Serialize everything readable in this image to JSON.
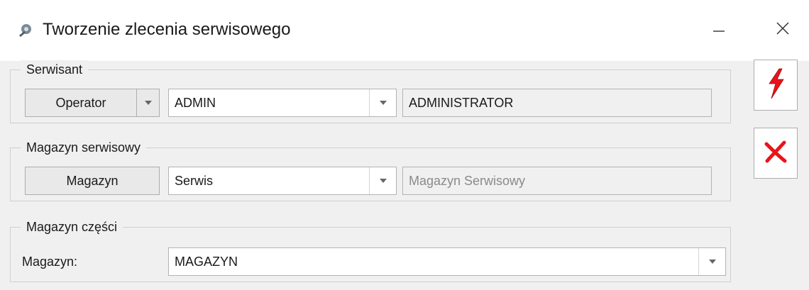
{
  "window": {
    "title": "Tworzenie zlecenia serwisowego",
    "icon": "service-gear-icon"
  },
  "groups": {
    "serwisant": {
      "legend": "Serwisant",
      "button_label": "Operator",
      "combo_value": "ADMIN",
      "readonly_value": "ADMINISTRATOR"
    },
    "magazyn_serwisowy": {
      "legend": "Magazyn serwisowy",
      "button_label": "Magazyn",
      "combo_value": "Serwis",
      "readonly_value": "Magazyn Serwisowy"
    },
    "magazyn_czesci": {
      "legend": "Magazyn części",
      "field_label": "Magazyn:",
      "combo_value": "MAGAZYN"
    }
  },
  "actions": {
    "confirm_icon": "lightning-icon",
    "cancel_icon": "red-x-icon"
  },
  "colors": {
    "accent_red": "#e8141b",
    "window_bg": "#f0f0f0",
    "titlebar_bg": "#ffffff"
  }
}
